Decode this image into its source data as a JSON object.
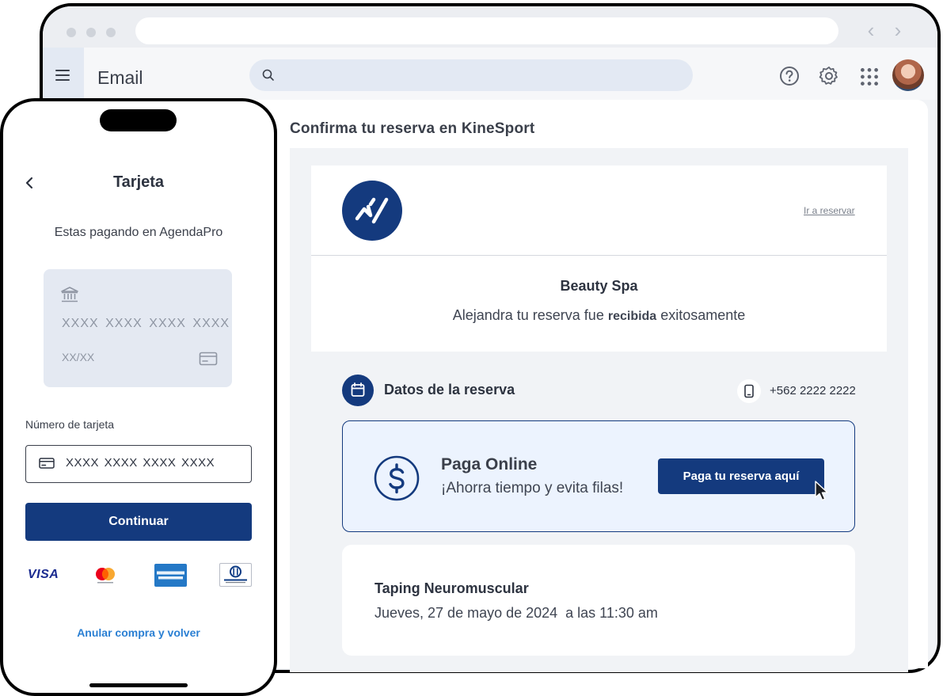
{
  "browser": {
    "app_title": "Email",
    "icons": [
      "help-icon",
      "gear-icon",
      "apps-grid-icon",
      "avatar"
    ]
  },
  "email": {
    "subject": "Confirma tu reserva en KineSport",
    "go_to_booking_link": "Ir a reservar",
    "business_name": "Beauty Spa",
    "confirmation": {
      "prefix": "Alejandra tu reserva fue ",
      "bold": "recibida",
      "suffix": " exitosamente"
    },
    "section_title": "Datos de la reserva",
    "phone": "+562 2222 2222",
    "pay_online": {
      "title": "Paga Online",
      "subtitle": "¡Ahorra tiempo y evita filas!",
      "button": "Paga tu reserva aquí"
    },
    "service": {
      "name": "Taping Neuromuscular",
      "datetime": "Jueves, 27 de mayo de 2024  a las 11:30 am"
    }
  },
  "mobile": {
    "title": "Tarjeta",
    "paying_in": "Estas pagando en AgendaPro",
    "card_preview": {
      "number_mask": "XXXX XXXX XXXX XXXX",
      "expiry_mask": "XX/XX"
    },
    "field_label": "Número de tarjeta",
    "field_value": "XXXX XXXX XXXX XXXX",
    "continue_button": "Continuar",
    "card_brands": [
      "VISA",
      "mastercard",
      "AMERICAN EXPRESS",
      "Diners Club"
    ],
    "visa_label": "VISA",
    "cancel_link": "Anular compra y volver"
  },
  "colors": {
    "brand_navy": "#143a7e",
    "link_blue": "#2a7fd3",
    "pay_box_bg": "#ecf3fe"
  }
}
